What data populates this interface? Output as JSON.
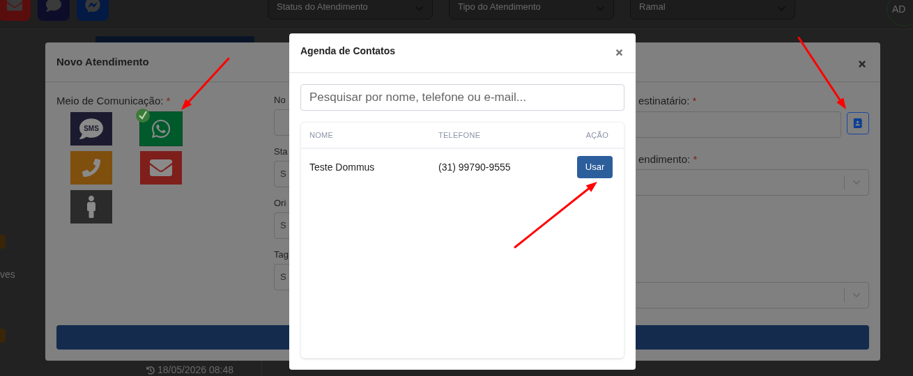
{
  "background": {
    "channel_buttons": [
      {
        "kind": "email"
      },
      {
        "kind": "chat"
      },
      {
        "kind": "messenger"
      }
    ],
    "filters": [
      {
        "label": "Status do Atendimento"
      },
      {
        "label": "Tipo do Atendimento"
      },
      {
        "label": "Ramal"
      }
    ],
    "avatar": "AD",
    "side_text": "ves",
    "timestamp": "18/05/2026 08:48"
  },
  "new_ticket_modal": {
    "title": "Novo Atendimento",
    "media_label": {
      "text": "Meio de Comunicação:",
      "mark": "*"
    },
    "channels": [
      {
        "kind": "sms",
        "label": "SMS",
        "selected": false
      },
      {
        "kind": "whatsapp",
        "selected": true
      },
      {
        "kind": "phone",
        "selected": false
      },
      {
        "kind": "email",
        "selected": false
      },
      {
        "kind": "in_person",
        "selected": false
      }
    ],
    "middle_fields": [
      {
        "label": "No"
      },
      {
        "label": "Sta",
        "placeholder": "S"
      },
      {
        "label": "Ori",
        "placeholder": "S"
      },
      {
        "label": "Tag",
        "placeholder": "S"
      }
    ],
    "recipient_label": {
      "text": "estinatário:",
      "mark": "*"
    },
    "attendance_label": {
      "text": "endimento:",
      "mark": "*"
    }
  },
  "contacts_modal": {
    "title": "Agenda de Contatos",
    "search_placeholder": "Pesquisar por nome, telefone ou e-mail...",
    "columns": [
      "NOME",
      "TELEFONE",
      "AÇÃO"
    ],
    "rows": [
      {
        "name": "Teste Dommus",
        "phone": "(31) 99790-9555",
        "action": "Usar"
      }
    ]
  }
}
